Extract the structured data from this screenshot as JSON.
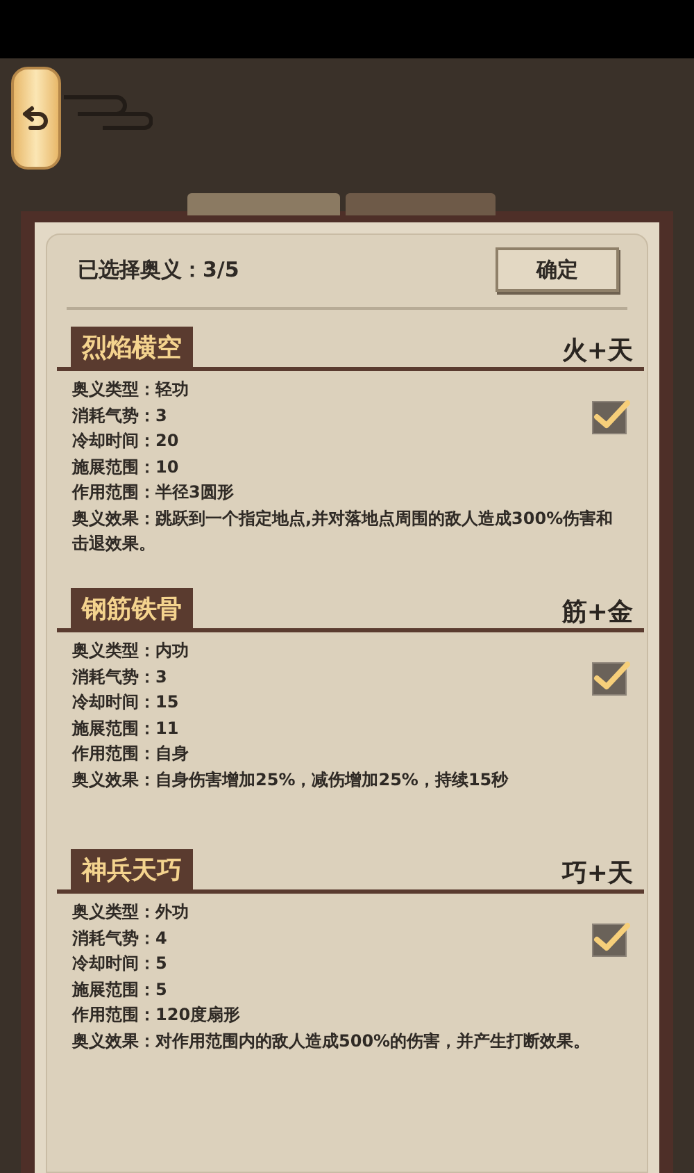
{
  "header": {
    "selection_label": "已选择奥义：3/5",
    "confirm_button": "确定"
  },
  "skills": [
    {
      "name": "烈焰横空",
      "combo": "火+天",
      "checked": true,
      "lines": [
        "奥义类型：轻功",
        "消耗气势：3",
        "冷却时间：20",
        "施展范围：10",
        "作用范围：半径3圆形",
        "奥义效果：跳跃到一个指定地点,并对落地点周围的敌人造成300%伤害和击退效果。"
      ]
    },
    {
      "name": "钢筋铁骨",
      "combo": "筋+金",
      "checked": true,
      "lines": [
        "奥义类型：内功",
        "消耗气势：3",
        "冷却时间：15",
        "施展范围：11",
        "作用范围：自身",
        "奥义效果：自身伤害增加25%，减伤增加25%，持续15秒"
      ]
    },
    {
      "name": "神兵天巧",
      "combo": "巧+天",
      "checked": true,
      "lines": [
        "奥义类型：外功",
        "消耗气势：4",
        "冷却时间：5",
        "施展范围：5",
        "作用范围：120度扇形",
        "奥义效果：对作用范围内的敌人造成500%的伤害，并产生打断效果。"
      ]
    }
  ]
}
